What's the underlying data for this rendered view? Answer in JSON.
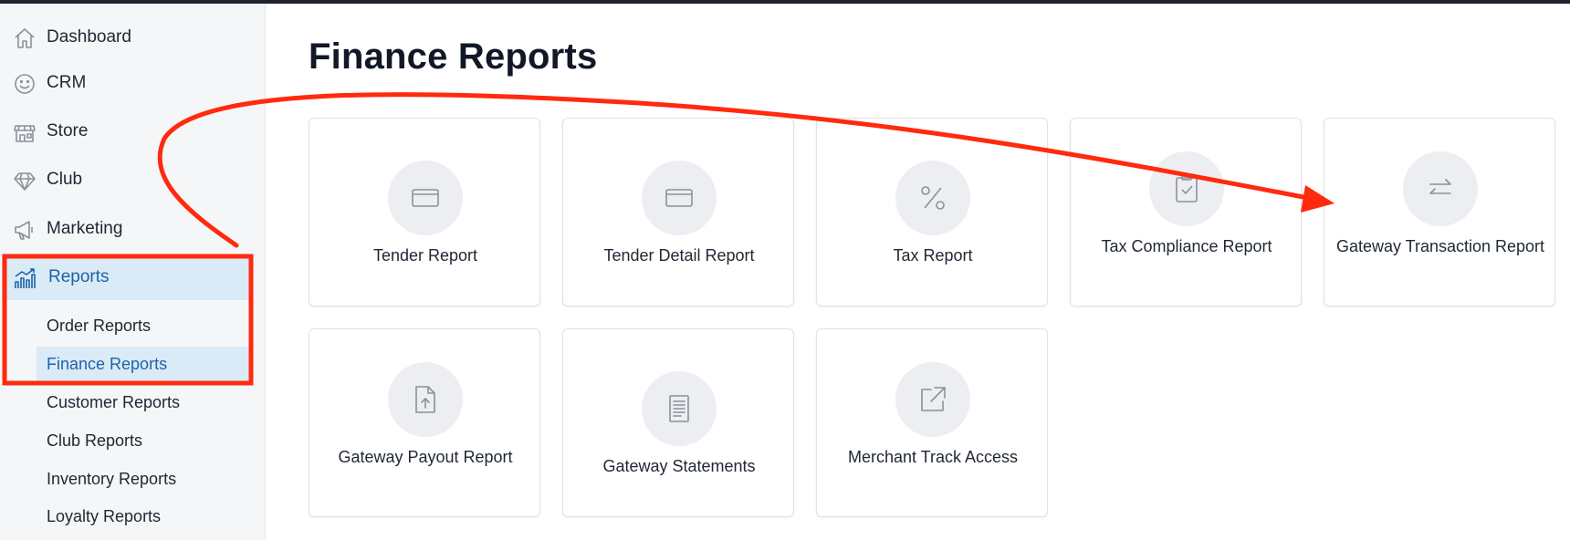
{
  "sidebar": {
    "items": [
      {
        "label": "Dashboard",
        "icon": "home-icon"
      },
      {
        "label": "CRM",
        "icon": "smiley-icon"
      },
      {
        "label": "Store",
        "icon": "storefront-icon"
      },
      {
        "label": "Club",
        "icon": "diamond-icon"
      },
      {
        "label": "Marketing",
        "icon": "megaphone-icon"
      },
      {
        "label": "Reports",
        "icon": "chart-icon",
        "active": true
      }
    ],
    "sub_items": [
      {
        "label": "Order Reports"
      },
      {
        "label": "Finance Reports",
        "active": true
      },
      {
        "label": "Customer Reports"
      },
      {
        "label": "Club Reports"
      },
      {
        "label": "Inventory Reports"
      },
      {
        "label": "Loyalty Reports"
      }
    ]
  },
  "main": {
    "title": "Finance Reports",
    "cards": [
      {
        "title": "Tender Report",
        "icon": "credit-card-icon"
      },
      {
        "title": "Tender Detail Report",
        "icon": "credit-card-icon"
      },
      {
        "title": "Tax Report",
        "icon": "percent-icon"
      },
      {
        "title": "Tax Compliance Report",
        "icon": "clipboard-check-icon"
      },
      {
        "title": "Gateway Transaction Report",
        "icon": "arrows-exchange-icon"
      },
      {
        "title": "Gateway Payout Report",
        "icon": "file-upload-icon"
      },
      {
        "title": "Gateway Statements",
        "icon": "document-lines-icon"
      },
      {
        "title": "Merchant Track Access",
        "icon": "external-link-icon"
      }
    ]
  },
  "colors": {
    "accent": "#1b64a8",
    "active_bg": "#daeaf7",
    "annotation": "#ff2a0e"
  }
}
